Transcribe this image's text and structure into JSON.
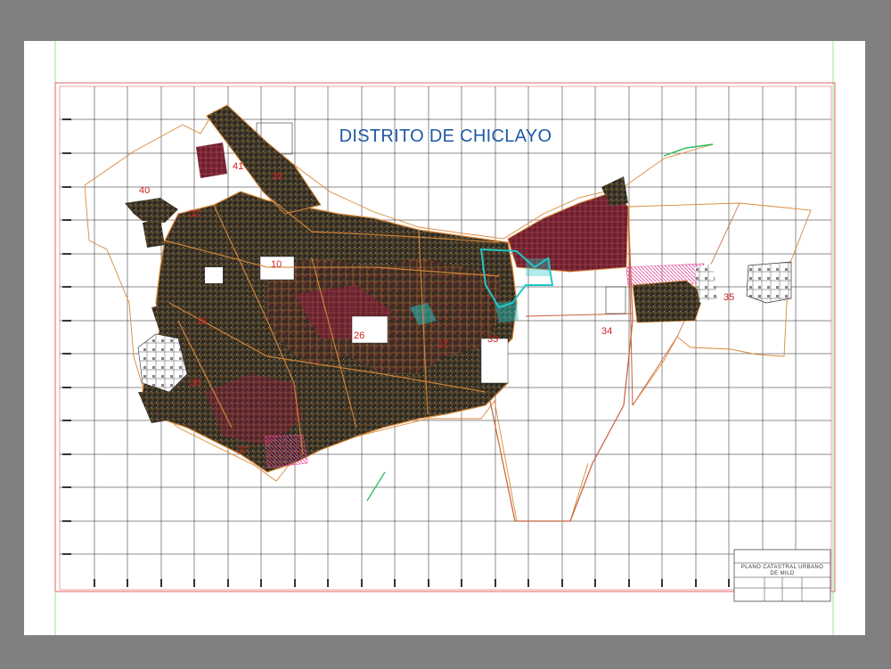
{
  "map": {
    "title": "DISTRITO DE CHICLAYO",
    "zones": [
      {
        "id": "z40",
        "label": "40"
      },
      {
        "id": "z41",
        "label": "41"
      },
      {
        "id": "z39",
        "label": "39"
      },
      {
        "id": "z02",
        "label": "02"
      },
      {
        "id": "z10",
        "label": "10"
      },
      {
        "id": "z16",
        "label": "16"
      },
      {
        "id": "z26",
        "label": "26"
      },
      {
        "id": "z38",
        "label": "38"
      },
      {
        "id": "z37",
        "label": "37"
      },
      {
        "id": "z33",
        "label": "33"
      },
      {
        "id": "z27",
        "label": "27"
      },
      {
        "id": "z34",
        "label": "34"
      },
      {
        "id": "z35",
        "label": "35"
      }
    ]
  },
  "title_block": {
    "line1": "PLANO CATASTRAL URBANO",
    "line2": "DE MILD"
  },
  "colors": {
    "background": "#808080",
    "sheet": "#ffffff",
    "frame": "#e06666",
    "grid": "#1a1a1a",
    "title": "#1f5aa6",
    "zone_label": "#d11f1f",
    "urban_dark": "#2d2a22",
    "urban_maroon": "#6e1f2f",
    "roads": "#d98a3a",
    "boundary": "#c8603a",
    "cyan": "#22c7c7",
    "magenta": "#e2459a"
  }
}
